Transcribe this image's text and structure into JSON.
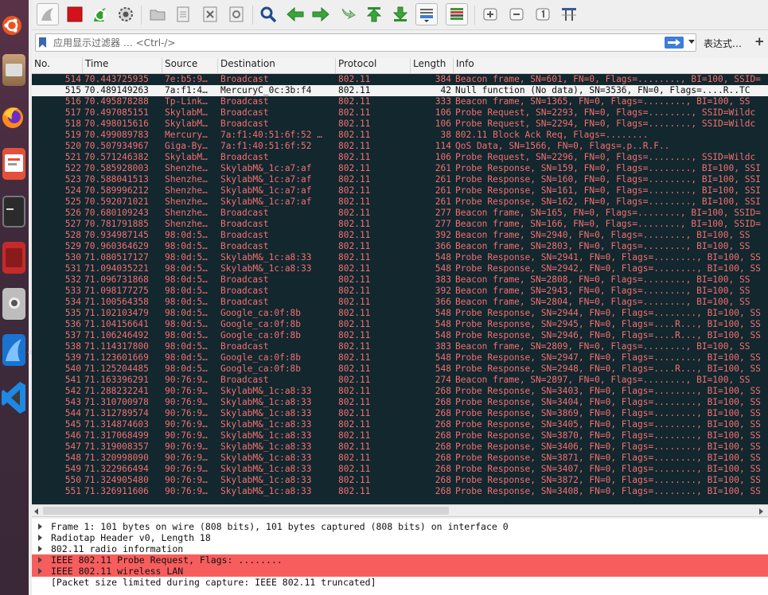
{
  "launcher": {
    "icons": [
      "ubuntu-dash-icon",
      "files-icon",
      "firefox-icon",
      "presentation-icon",
      "terminal-icon",
      "app-icon",
      "camera-icon",
      "wireshark-icon",
      "vscode-icon"
    ]
  },
  "toolbar": {
    "buttons": [
      "start-capture",
      "stop-capture",
      "restart-capture",
      "capture-options",
      "open-file",
      "save-file",
      "close-file",
      "reload-file",
      "find-packet",
      "go-back",
      "go-forward",
      "go-to-packet",
      "go-first",
      "go-last",
      "auto-scroll",
      "colorize",
      "zoom-in",
      "zoom-out",
      "normal-size",
      "resize-columns"
    ]
  },
  "filter": {
    "placeholder": "应用显示过滤器 … <Ctrl-/>",
    "expression_label": "表达式…",
    "plus_label": "+"
  },
  "columns": {
    "no": "No.",
    "time": "Time",
    "source": "Source",
    "destination": "Destination",
    "protocol": "Protocol",
    "length": "Length",
    "info": "Info"
  },
  "packets": [
    {
      "no": "514",
      "time": "70.443725935",
      "src": "7e:b5:9…",
      "dst": "Broadcast",
      "proto": "802.11",
      "len": "384",
      "info": "Beacon frame, SN=601, FN=0, Flags=........, BI=100, SSID=",
      "selected": false
    },
    {
      "no": "515",
      "time": "70.489149263",
      "src": "7a:f1:4…",
      "dst": "MercuryC_0c:3b:f4",
      "proto": "802.11",
      "len": "42",
      "info": "Null function (No data), SN=3536, FN=0, Flags=....R..TC",
      "selected": true
    },
    {
      "no": "516",
      "time": "70.495878288",
      "src": "Tp-Link…",
      "dst": "Broadcast",
      "proto": "802.11",
      "len": "333",
      "info": "Beacon frame, SN=1365, FN=0, Flags=........, BI=100, SS",
      "selected": false
    },
    {
      "no": "517",
      "time": "70.497085151",
      "src": "SkylabM…",
      "dst": "Broadcast",
      "proto": "802.11",
      "len": "106",
      "info": "Probe Request, SN=2293, FN=0, Flags=........, SSID=Wildc",
      "selected": false
    },
    {
      "no": "518",
      "time": "70.498015616",
      "src": "SkylabM…",
      "dst": "Broadcast",
      "proto": "802.11",
      "len": "106",
      "info": "Probe Request, SN=2294, FN=0, Flags=........, SSID=Wildc",
      "selected": false
    },
    {
      "no": "519",
      "time": "70.499089783",
      "src": "Mercury…",
      "dst": "7a:f1:40:51:6f:52 …",
      "proto": "802.11",
      "len": "38",
      "info": "802.11 Block Ack Req, Flags=........",
      "selected": false
    },
    {
      "no": "520",
      "time": "70.507934967",
      "src": "Giga-By…",
      "dst": "7a:f1:40:51:6f:52",
      "proto": "802.11",
      "len": "114",
      "info": "QoS Data, SN=1566, FN=0, Flags=.p..R.F..",
      "selected": false
    },
    {
      "no": "521",
      "time": "70.571246382",
      "src": "SkylabM…",
      "dst": "Broadcast",
      "proto": "802.11",
      "len": "106",
      "info": "Probe Request, SN=2296, FN=0, Flags=........, SSID=Wildc",
      "selected": false
    },
    {
      "no": "522",
      "time": "70.585928003",
      "src": "Shenzhe…",
      "dst": "SkylabM&_1c:a7:af",
      "proto": "802.11",
      "len": "261",
      "info": "Probe Response, SN=159, FN=0, Flags=........, BI=100, SSI",
      "selected": false
    },
    {
      "no": "523",
      "time": "70.588041513",
      "src": "Shenzhe…",
      "dst": "SkylabM&_1c:a7:af",
      "proto": "802.11",
      "len": "261",
      "info": "Probe Response, SN=160, FN=0, Flags=........, BI=100, SSI",
      "selected": false
    },
    {
      "no": "524",
      "time": "70.589996212",
      "src": "Shenzhe…",
      "dst": "SkylabM&_1c:a7:af",
      "proto": "802.11",
      "len": "261",
      "info": "Probe Response, SN=161, FN=0, Flags=........, BI=100, SSI",
      "selected": false
    },
    {
      "no": "525",
      "time": "70.592071021",
      "src": "Shenzhe…",
      "dst": "SkylabM&_1c:a7:af",
      "proto": "802.11",
      "len": "261",
      "info": "Probe Response, SN=162, FN=0, Flags=........, BI=100, SSI",
      "selected": false
    },
    {
      "no": "526",
      "time": "70.680109243",
      "src": "Shenzhe…",
      "dst": "Broadcast",
      "proto": "802.11",
      "len": "277",
      "info": "Beacon frame, SN=165, FN=0, Flags=........, BI=100, SSID=",
      "selected": false
    },
    {
      "no": "527",
      "time": "70.781791885",
      "src": "Shenzhe…",
      "dst": "Broadcast",
      "proto": "802.11",
      "len": "277",
      "info": "Beacon frame, SN=166, FN=0, Flags=........, BI=100, SSID=",
      "selected": false
    },
    {
      "no": "528",
      "time": "70.934987145",
      "src": "98:0d:5…",
      "dst": "Broadcast",
      "proto": "802.11",
      "len": "392",
      "info": "Beacon frame, SN=2940, FN=0, Flags=........, BI=100, SS",
      "selected": false
    },
    {
      "no": "529",
      "time": "70.960364629",
      "src": "98:0d:5…",
      "dst": "Broadcast",
      "proto": "802.11",
      "len": "366",
      "info": "Beacon frame, SN=2803, FN=0, Flags=........, BI=100, SS",
      "selected": false
    },
    {
      "no": "530",
      "time": "71.080517127",
      "src": "98:0d:5…",
      "dst": "SkylabM&_1c:a8:33",
      "proto": "802.11",
      "len": "548",
      "info": "Probe Response, SN=2941, FN=0, Flags=........, BI=100, SS",
      "selected": false
    },
    {
      "no": "531",
      "time": "71.094035221",
      "src": "98:0d:5…",
      "dst": "SkylabM&_1c:a8:33",
      "proto": "802.11",
      "len": "548",
      "info": "Probe Response, SN=2942, FN=0, Flags=........, BI=100, SS",
      "selected": false
    },
    {
      "no": "532",
      "time": "71.096731868",
      "src": "98:0d:5…",
      "dst": "Broadcast",
      "proto": "802.11",
      "len": "383",
      "info": "Beacon frame, SN=2808, FN=0, Flags=........, BI=100, SS",
      "selected": false
    },
    {
      "no": "533",
      "time": "71.098177275",
      "src": "98:0d:5…",
      "dst": "Broadcast",
      "proto": "802.11",
      "len": "392",
      "info": "Beacon frame, SN=2943, FN=0, Flags=........, BI=100, SS",
      "selected": false
    },
    {
      "no": "534",
      "time": "71.100564358",
      "src": "98:0d:5…",
      "dst": "Broadcast",
      "proto": "802.11",
      "len": "366",
      "info": "Beacon frame, SN=2804, FN=0, Flags=........, BI=100, SS",
      "selected": false
    },
    {
      "no": "535",
      "time": "71.102103479",
      "src": "98:0d:5…",
      "dst": "Google_ca:0f:8b",
      "proto": "802.11",
      "len": "548",
      "info": "Probe Response, SN=2944, FN=0, Flags=........, BI=100, SS",
      "selected": false
    },
    {
      "no": "536",
      "time": "71.104156641",
      "src": "98:0d:5…",
      "dst": "Google_ca:0f:8b",
      "proto": "802.11",
      "len": "548",
      "info": "Probe Response, SN=2945, FN=0, Flags=....R..., BI=100, SS",
      "selected": false
    },
    {
      "no": "537",
      "time": "71.106246492",
      "src": "98:0d:5…",
      "dst": "Google_ca:0f:8b",
      "proto": "802.11",
      "len": "548",
      "info": "Probe Response, SN=2946, FN=0, Flags=....R..., BI=100, SS",
      "selected": false
    },
    {
      "no": "538",
      "time": "71.114317800",
      "src": "98:0d:5…",
      "dst": "Broadcast",
      "proto": "802.11",
      "len": "383",
      "info": "Beacon frame, SN=2809, FN=0, Flags=........, BI=100, SS",
      "selected": false
    },
    {
      "no": "539",
      "time": "71.123601669",
      "src": "98:0d:5…",
      "dst": "Google_ca:0f:8b",
      "proto": "802.11",
      "len": "548",
      "info": "Probe Response, SN=2947, FN=0, Flags=........, BI=100, SS",
      "selected": false
    },
    {
      "no": "540",
      "time": "71.125204485",
      "src": "98:0d:5…",
      "dst": "Google_ca:0f:8b",
      "proto": "802.11",
      "len": "548",
      "info": "Probe Response, SN=2948, FN=0, Flags=....R..., BI=100, SS",
      "selected": false
    },
    {
      "no": "541",
      "time": "71.163396291",
      "src": "90:76:9…",
      "dst": "Broadcast",
      "proto": "802.11",
      "len": "274",
      "info": "Beacon frame, SN=2897, FN=0, Flags=........, BI=100, SS",
      "selected": false
    },
    {
      "no": "542",
      "time": "71.288232241",
      "src": "90:76:9…",
      "dst": "SkylabM&_1c:a8:33",
      "proto": "802.11",
      "len": "268",
      "info": "Probe Response, SN=3403, FN=0, Flags=........, BI=100, SS",
      "selected": false
    },
    {
      "no": "543",
      "time": "71.310700978",
      "src": "90:76:9…",
      "dst": "SkylabM&_1c:a8:33",
      "proto": "802.11",
      "len": "268",
      "info": "Probe Response, SN=3404, FN=0, Flags=........, BI=100, SS",
      "selected": false
    },
    {
      "no": "544",
      "time": "71.312789574",
      "src": "90:76:9…",
      "dst": "SkylabM&_1c:a8:33",
      "proto": "802.11",
      "len": "268",
      "info": "Probe Response, SN=3869, FN=0, Flags=........, BI=100, SS",
      "selected": false
    },
    {
      "no": "545",
      "time": "71.314874603",
      "src": "90:76:9…",
      "dst": "SkylabM&_1c:a8:33",
      "proto": "802.11",
      "len": "268",
      "info": "Probe Response, SN=3405, FN=0, Flags=........, BI=100, SS",
      "selected": false
    },
    {
      "no": "546",
      "time": "71.317068499",
      "src": "90:76:9…",
      "dst": "SkylabM&_1c:a8:33",
      "proto": "802.11",
      "len": "268",
      "info": "Probe Response, SN=3870, FN=0, Flags=........, BI=100, SS",
      "selected": false
    },
    {
      "no": "547",
      "time": "71.319008357",
      "src": "90:76:9…",
      "dst": "SkylabM&_1c:a8:33",
      "proto": "802.11",
      "len": "268",
      "info": "Probe Response, SN=3406, FN=0, Flags=........, BI=100, SS",
      "selected": false
    },
    {
      "no": "548",
      "time": "71.320998090",
      "src": "90:76:9…",
      "dst": "SkylabM&_1c:a8:33",
      "proto": "802.11",
      "len": "268",
      "info": "Probe Response, SN=3871, FN=0, Flags=........, BI=100, SS",
      "selected": false
    },
    {
      "no": "549",
      "time": "71.322966494",
      "src": "90:76:9…",
      "dst": "SkylabM&_1c:a8:33",
      "proto": "802.11",
      "len": "268",
      "info": "Probe Response, SN=3407, FN=0, Flags=........, BI=100, SS",
      "selected": false
    },
    {
      "no": "550",
      "time": "71.324905480",
      "src": "90:76:9…",
      "dst": "SkylabM&_1c:a8:33",
      "proto": "802.11",
      "len": "268",
      "info": "Probe Response, SN=3872, FN=0, Flags=........, BI=100, SS",
      "selected": false
    },
    {
      "no": "551",
      "time": "71.326911606",
      "src": "90:76:9…",
      "dst": "SkylabM&_1c:a8:33",
      "proto": "802.11",
      "len": "268",
      "info": "Probe Response, SN=3408, FN=0, Flags=........, BI=100, SS",
      "selected": false
    }
  ],
  "details": [
    {
      "text": "Frame 1: 101 bytes on wire (808 bits), 101 bytes captured (808 bits) on interface 0",
      "expandable": true,
      "highlight": false
    },
    {
      "text": "Radiotap Header v0, Length 18",
      "expandable": true,
      "highlight": false
    },
    {
      "text": "802.11 radio information",
      "expandable": true,
      "highlight": false
    },
    {
      "text": "IEEE 802.11 Probe Request, Flags: ........",
      "expandable": true,
      "highlight": true
    },
    {
      "text": "IEEE 802.11 wireless LAN",
      "expandable": true,
      "highlight": true
    },
    {
      "text": "[Packet size limited during capture: IEEE 802.11 truncated]",
      "expandable": false,
      "highlight": false
    }
  ],
  "colors": {
    "packet_bg": "#12272e",
    "packet_text": "#f36f6f",
    "selected_bg": "#f3f3f3",
    "detail_highlight": "#f75d5d",
    "apply_button": "#3c7ed9"
  }
}
